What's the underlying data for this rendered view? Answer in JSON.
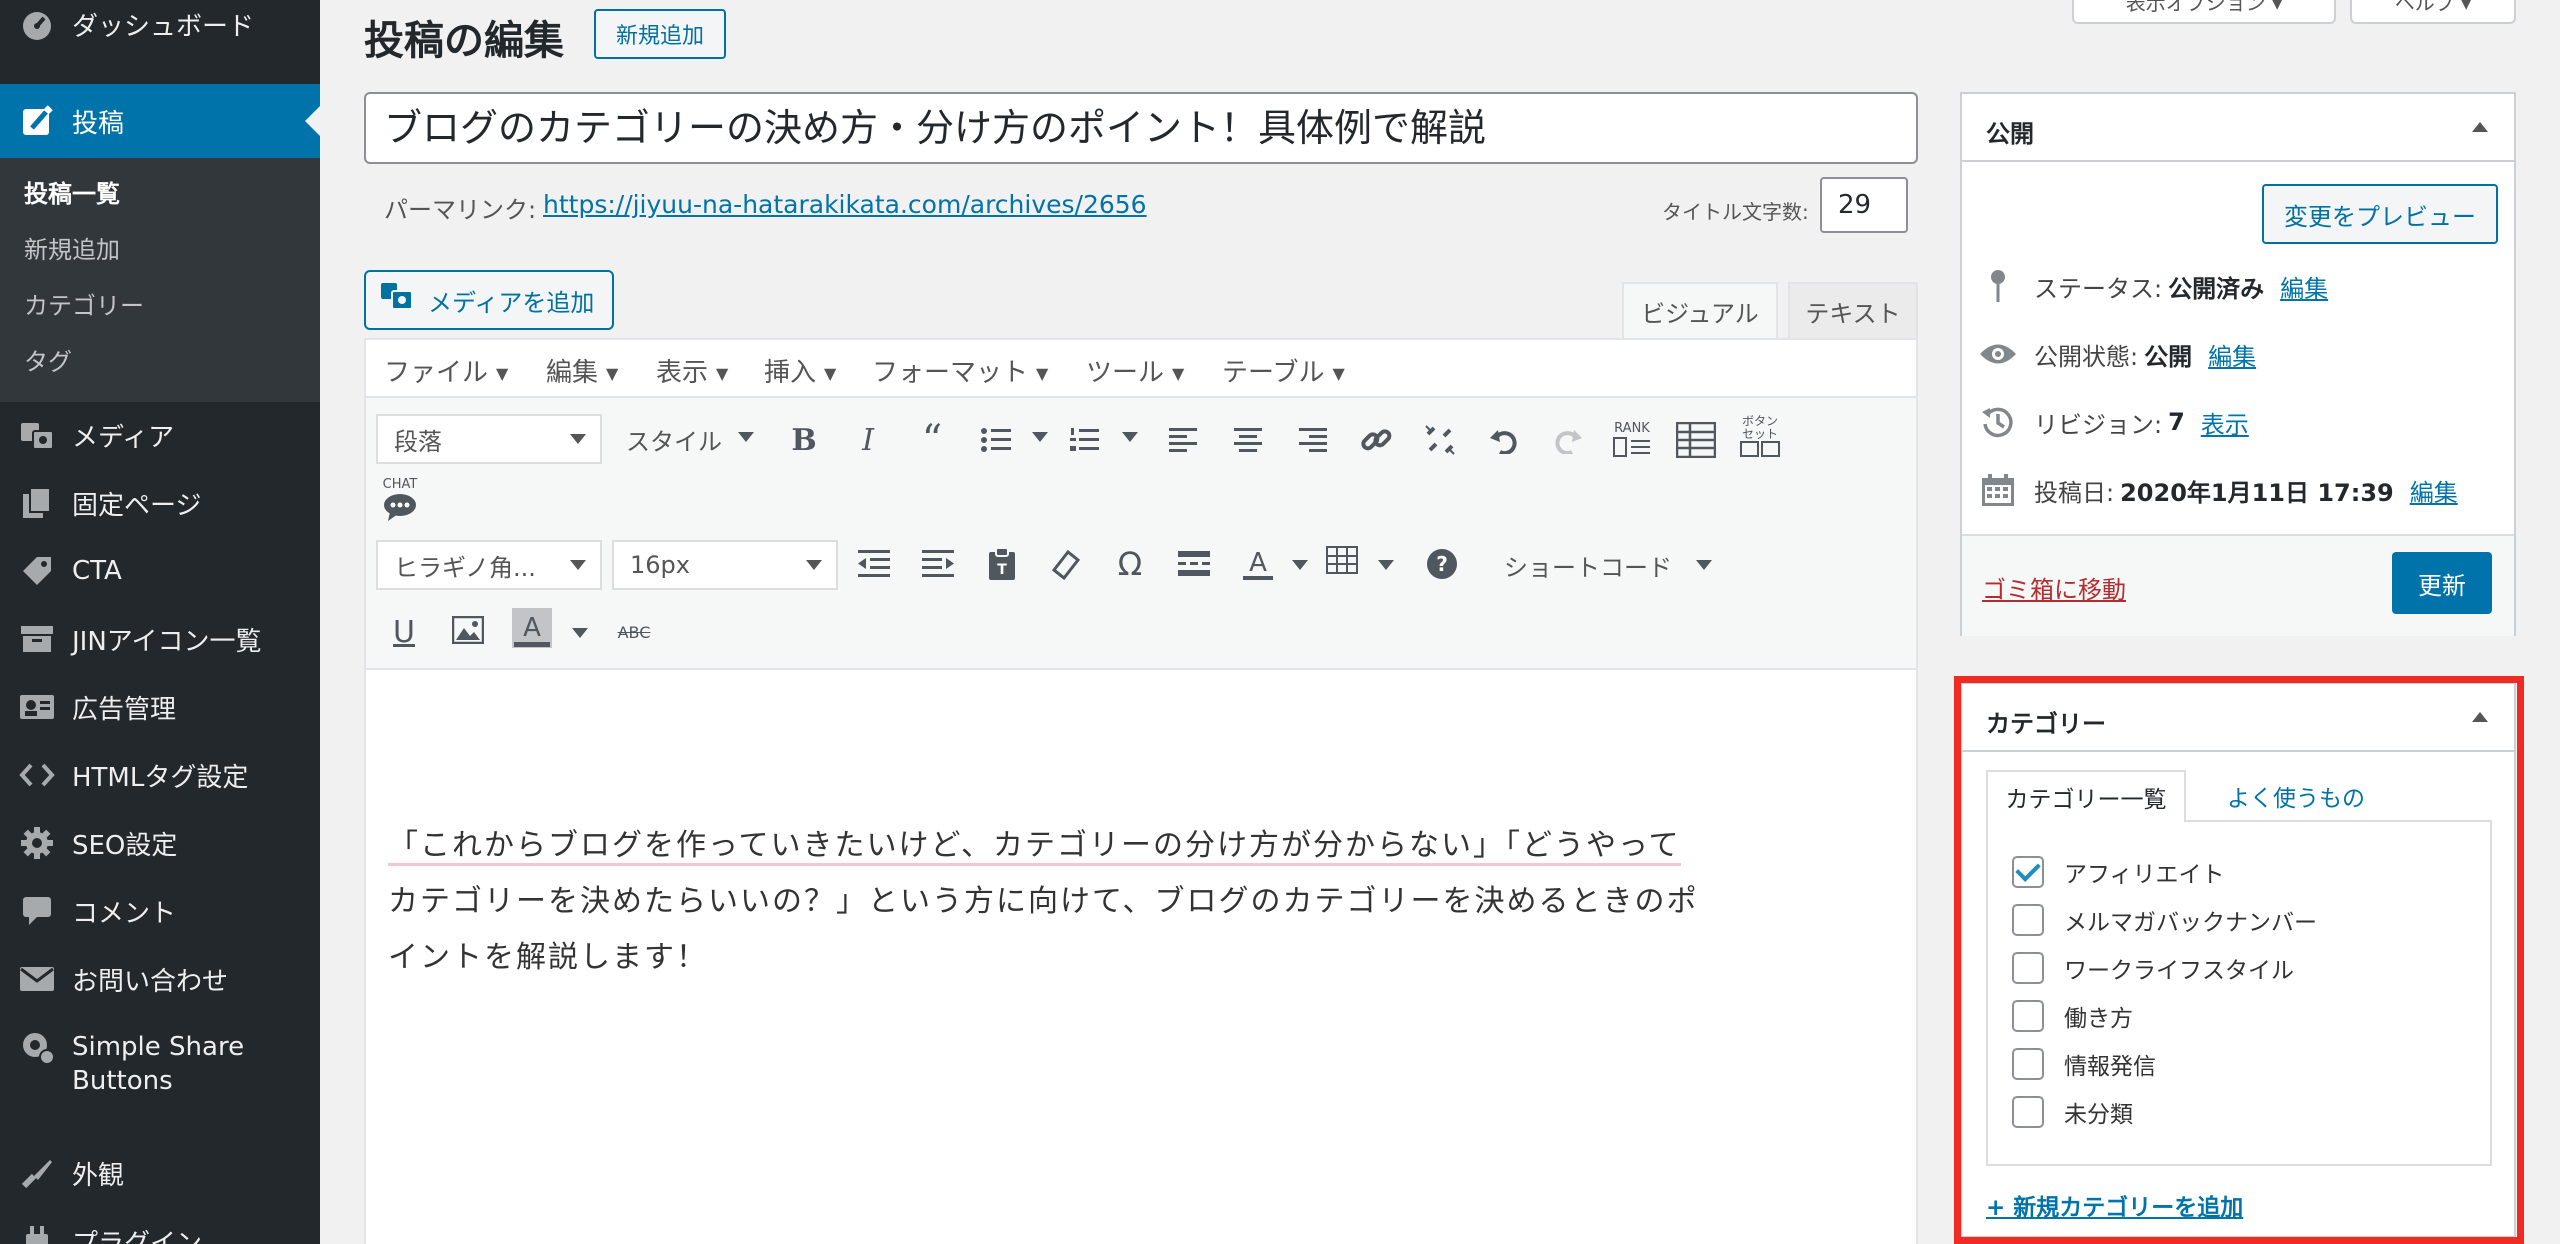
{
  "sidebar": {
    "items": [
      {
        "name": "dashboard",
        "label": "ダッシュボード",
        "icon": "dashboard-icon"
      },
      {
        "name": "posts",
        "label": "投稿",
        "icon": "pin-icon"
      },
      {
        "name": "media",
        "label": "メディア",
        "icon": "media-icon"
      },
      {
        "name": "pages",
        "label": "固定ページ",
        "icon": "pages-icon"
      },
      {
        "name": "cta",
        "label": "CTA",
        "icon": "tag-icon"
      },
      {
        "name": "jin-icons",
        "label": "JINアイコン一覧",
        "icon": "archive-icon"
      },
      {
        "name": "ads",
        "label": "広告管理",
        "icon": "id-card-icon"
      },
      {
        "name": "html-tags",
        "label": "HTMLタグ設定",
        "icon": "code-icon"
      },
      {
        "name": "seo",
        "label": "SEO設定",
        "icon": "gear-icon"
      },
      {
        "name": "comments",
        "label": "コメント",
        "icon": "comment-icon"
      },
      {
        "name": "contact",
        "label": "お問い合わせ",
        "icon": "mail-icon"
      },
      {
        "name": "simple-share",
        "label": "Simple Share",
        "label2": "Buttons",
        "icon": "share-gear-icon"
      },
      {
        "name": "appearance",
        "label": "外観",
        "icon": "brush-icon"
      },
      {
        "name": "plugins",
        "label": "プラグイン",
        "icon": "plugin-icon"
      }
    ],
    "submenu": [
      "投稿一覧",
      "新規追加",
      "カテゴリー",
      "タグ"
    ]
  },
  "header": {
    "title": "投稿の編集",
    "add_new": "新規追加",
    "screen_options": "表示オプション ▾",
    "help": "ヘルプ ▾"
  },
  "post": {
    "title": "ブログのカテゴリーの決め方・分け方のポイント！具体例で解説",
    "permalink_label": "パーマリンク:",
    "permalink_url": "https://jiyuu-na-hatarakikata.com/archives/2656",
    "title_count_label": "タイトル文字数:",
    "title_count": "29"
  },
  "editor": {
    "add_media": "メディアを追加",
    "tab_visual": "ビジュアル",
    "tab_text": "テキスト",
    "menubar": [
      "ファイル",
      "編集",
      "表示",
      "挿入",
      "フォーマット",
      "ツール",
      "テーブル"
    ],
    "format_select": "段落",
    "style_menu": "スタイル",
    "font_select": "ヒラギノ角...",
    "size_select": "16px",
    "shortcode_menu": "ショートコード",
    "rank_label": "RANK",
    "button_label_1": "ボタン",
    "button_label_2": "セット",
    "chat_label": "CHAT",
    "content_lines": [
      "「これからブログを作っていきたいけど、カテゴリーの分け方が分からない」「どうやって",
      "カテゴリーを決めたらいいの？」という方に向けて、ブログのカテゴリーを決めるときのポ",
      "イントを解説します！"
    ]
  },
  "publish": {
    "title": "公開",
    "preview": "変更をプレビュー",
    "status_label": "ステータス:",
    "status_value": "公開済み",
    "visibility_label": "公開状態:",
    "visibility_value": "公開",
    "revisions_label": "リビジョン:",
    "revisions_value": "7",
    "revisions_link": "表示",
    "date_label": "投稿日:",
    "date_value": "2020年1月11日 17:39",
    "edit": "編集",
    "trash": "ゴミ箱に移動",
    "update": "更新"
  },
  "categories": {
    "title": "カテゴリー",
    "tab_all": "カテゴリー一覧",
    "tab_popular": "よく使うもの",
    "items": [
      {
        "label": "アフィリエイト",
        "checked": true
      },
      {
        "label": "メルマガバックナンバー",
        "checked": false
      },
      {
        "label": "ワークライフスタイル",
        "checked": false
      },
      {
        "label": "働き方",
        "checked": false
      },
      {
        "label": "情報発信",
        "checked": false
      },
      {
        "label": "未分類",
        "checked": false
      }
    ],
    "add_new": "+ 新規カテゴリーを追加"
  },
  "colors": {
    "sidebar_bg": "#23282d",
    "active_blue": "#0073aa",
    "highlight_red": "#ef2b23"
  }
}
